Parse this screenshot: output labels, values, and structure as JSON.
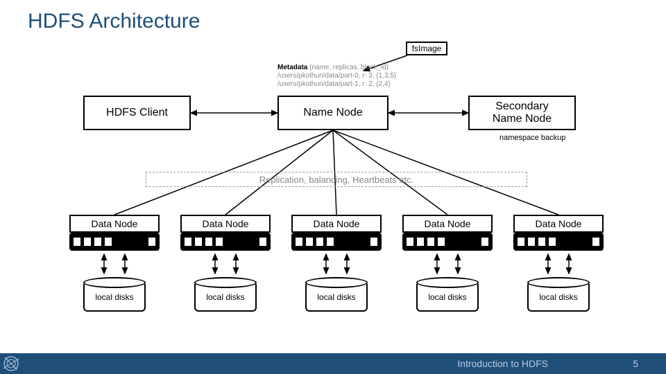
{
  "slide": {
    "title": "HDFS Architecture",
    "footer_title": "Introduction to HDFS",
    "page_number": "5"
  },
  "diagram": {
    "fsimage": "fsImage",
    "hdfs_client": "HDFS Client",
    "name_node": "Name Node",
    "secondary_name_node": "Secondary\nName Node",
    "namespace_backup": "namespace backup",
    "metadata_header": "Metadata",
    "metadata_detail": "(name, replicas, block_id)",
    "metadata_line1": "/users/pkothuri/data/part-0, r: 3, {1,3,5}",
    "metadata_line2": "/users/pkothuri/data/part-1, r: 2, {2,4}",
    "replication": "Replication, balancing, Heartbeats etc.",
    "data_node": "Data Node",
    "local_disks": "local disks"
  }
}
